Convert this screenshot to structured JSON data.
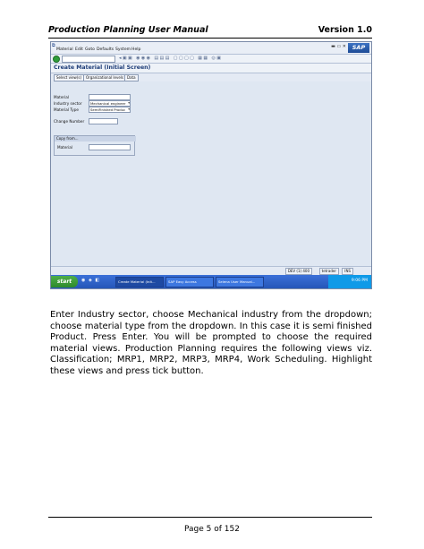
{
  "header": {
    "title": "Production Planning User Manual",
    "version": "Version 1.0"
  },
  "sap_window": {
    "menu": [
      "Material",
      "Edit",
      "Goto",
      "Defaults",
      "System",
      "Help"
    ],
    "logo": "SAP",
    "screen_title": "Create Material (Initial Screen)",
    "app_buttons": [
      "Select view(s)",
      "Organizational levels",
      "Data"
    ],
    "fields": {
      "material_label": "Material",
      "industry_label": "Industry sector",
      "industry_value": "Mechanical engineer",
      "type_label": "Material Type",
      "type_value": "SemiFinished Produc",
      "change_label": "Change Number"
    },
    "copy_from": {
      "title": "Copy from...",
      "material_label": "Material"
    },
    "status": {
      "system": "DEV (1) 400",
      "server": "tetrader",
      "mode": "INS"
    },
    "taskbar": {
      "start": "start",
      "tasks": [
        "Create Material (Init...",
        "SAP Easy Access",
        "Selena User Manual..."
      ],
      "clock": "9:06 PM"
    }
  },
  "body_text": "Enter Industry sector, choose Mechanical industry from the dropdown; choose material type from the dropdown. In this case it is semi finished Product. Press Enter. You will be prompted to choose the required material views. Production Planning requires the following views viz. Classification; MRP1, MRP2, MRP3, MRP4, Work Scheduling. Highlight these views and press tick button.",
  "footer": {
    "page": "Page 5 of 152"
  }
}
